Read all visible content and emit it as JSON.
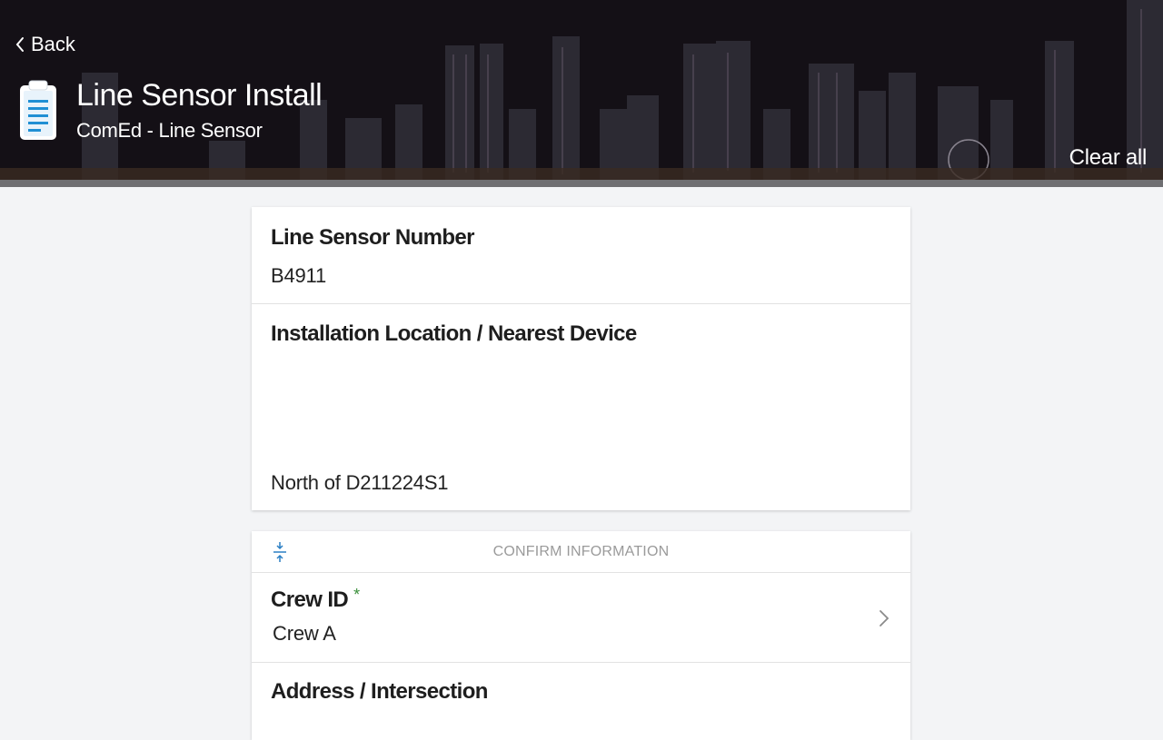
{
  "header": {
    "back_label": "Back",
    "title": "Line Sensor Install",
    "subtitle": "ComEd - Line Sensor",
    "clear_all_label": "Clear all",
    "form_icon": "clipboard-icon"
  },
  "details": {
    "line_sensor_number_label": "Line Sensor Number",
    "line_sensor_number_value": "B4911",
    "installation_location_label": "Installation Location / Nearest Device",
    "installation_location_value": "North of D211224S1"
  },
  "confirm_section": {
    "heading": "CONFIRM INFORMATION",
    "crew_id_label": "Crew ID",
    "required_mark": "*",
    "crew_id_value": "Crew A",
    "address_label": "Address / Intersection"
  },
  "colors": {
    "required": "#3a8f3a",
    "header_bg": "#1b1418",
    "page_bg": "#f3f4f6"
  }
}
